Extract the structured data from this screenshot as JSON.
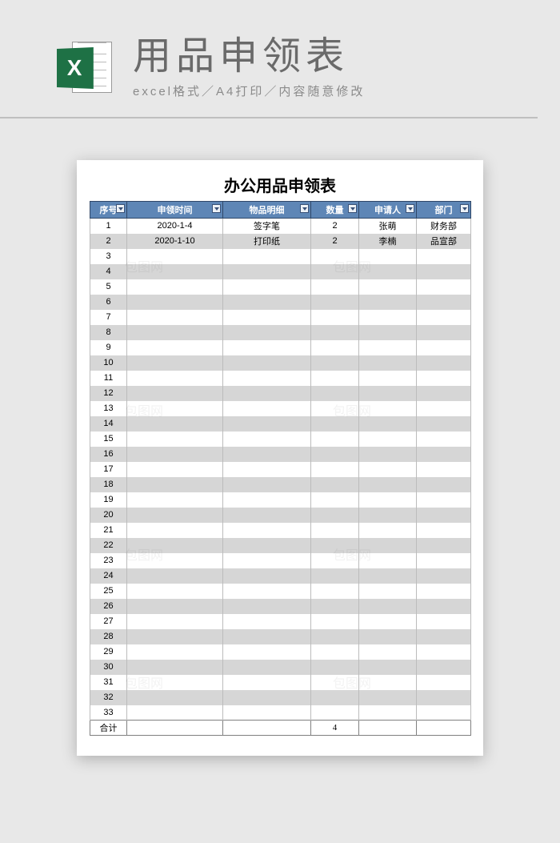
{
  "banner": {
    "title": "用品申领表",
    "subtitle": "excel格式／A4打印／内容随意修改",
    "icon_letter": "X"
  },
  "sheet": {
    "title": "办公用品申领表",
    "columns": [
      "序号",
      "申领时间",
      "物品明细",
      "数量",
      "申请人",
      "部门"
    ],
    "rows": [
      {
        "seq": "1",
        "date": "2020-1-4",
        "item": "签字笔",
        "qty": "2",
        "person": "张萌",
        "dept": "财务部"
      },
      {
        "seq": "2",
        "date": "2020-1-10",
        "item": "打印纸",
        "qty": "2",
        "person": "李楠",
        "dept": "品宣部"
      },
      {
        "seq": "3",
        "date": "",
        "item": "",
        "qty": "",
        "person": "",
        "dept": ""
      },
      {
        "seq": "4",
        "date": "",
        "item": "",
        "qty": "",
        "person": "",
        "dept": ""
      },
      {
        "seq": "5",
        "date": "",
        "item": "",
        "qty": "",
        "person": "",
        "dept": ""
      },
      {
        "seq": "6",
        "date": "",
        "item": "",
        "qty": "",
        "person": "",
        "dept": ""
      },
      {
        "seq": "7",
        "date": "",
        "item": "",
        "qty": "",
        "person": "",
        "dept": ""
      },
      {
        "seq": "8",
        "date": "",
        "item": "",
        "qty": "",
        "person": "",
        "dept": ""
      },
      {
        "seq": "9",
        "date": "",
        "item": "",
        "qty": "",
        "person": "",
        "dept": ""
      },
      {
        "seq": "10",
        "date": "",
        "item": "",
        "qty": "",
        "person": "",
        "dept": ""
      },
      {
        "seq": "11",
        "date": "",
        "item": "",
        "qty": "",
        "person": "",
        "dept": ""
      },
      {
        "seq": "12",
        "date": "",
        "item": "",
        "qty": "",
        "person": "",
        "dept": ""
      },
      {
        "seq": "13",
        "date": "",
        "item": "",
        "qty": "",
        "person": "",
        "dept": ""
      },
      {
        "seq": "14",
        "date": "",
        "item": "",
        "qty": "",
        "person": "",
        "dept": ""
      },
      {
        "seq": "15",
        "date": "",
        "item": "",
        "qty": "",
        "person": "",
        "dept": ""
      },
      {
        "seq": "16",
        "date": "",
        "item": "",
        "qty": "",
        "person": "",
        "dept": ""
      },
      {
        "seq": "17",
        "date": "",
        "item": "",
        "qty": "",
        "person": "",
        "dept": ""
      },
      {
        "seq": "18",
        "date": "",
        "item": "",
        "qty": "",
        "person": "",
        "dept": ""
      },
      {
        "seq": "19",
        "date": "",
        "item": "",
        "qty": "",
        "person": "",
        "dept": ""
      },
      {
        "seq": "20",
        "date": "",
        "item": "",
        "qty": "",
        "person": "",
        "dept": ""
      },
      {
        "seq": "21",
        "date": "",
        "item": "",
        "qty": "",
        "person": "",
        "dept": ""
      },
      {
        "seq": "22",
        "date": "",
        "item": "",
        "qty": "",
        "person": "",
        "dept": ""
      },
      {
        "seq": "23",
        "date": "",
        "item": "",
        "qty": "",
        "person": "",
        "dept": ""
      },
      {
        "seq": "24",
        "date": "",
        "item": "",
        "qty": "",
        "person": "",
        "dept": ""
      },
      {
        "seq": "25",
        "date": "",
        "item": "",
        "qty": "",
        "person": "",
        "dept": ""
      },
      {
        "seq": "26",
        "date": "",
        "item": "",
        "qty": "",
        "person": "",
        "dept": ""
      },
      {
        "seq": "27",
        "date": "",
        "item": "",
        "qty": "",
        "person": "",
        "dept": ""
      },
      {
        "seq": "28",
        "date": "",
        "item": "",
        "qty": "",
        "person": "",
        "dept": ""
      },
      {
        "seq": "29",
        "date": "",
        "item": "",
        "qty": "",
        "person": "",
        "dept": ""
      },
      {
        "seq": "30",
        "date": "",
        "item": "",
        "qty": "",
        "person": "",
        "dept": ""
      },
      {
        "seq": "31",
        "date": "",
        "item": "",
        "qty": "",
        "person": "",
        "dept": ""
      },
      {
        "seq": "32",
        "date": "",
        "item": "",
        "qty": "",
        "person": "",
        "dept": ""
      },
      {
        "seq": "33",
        "date": "",
        "item": "",
        "qty": "",
        "person": "",
        "dept": ""
      }
    ],
    "footer": {
      "label": "合计",
      "qty_total": "4"
    }
  },
  "watermark": "包图网"
}
